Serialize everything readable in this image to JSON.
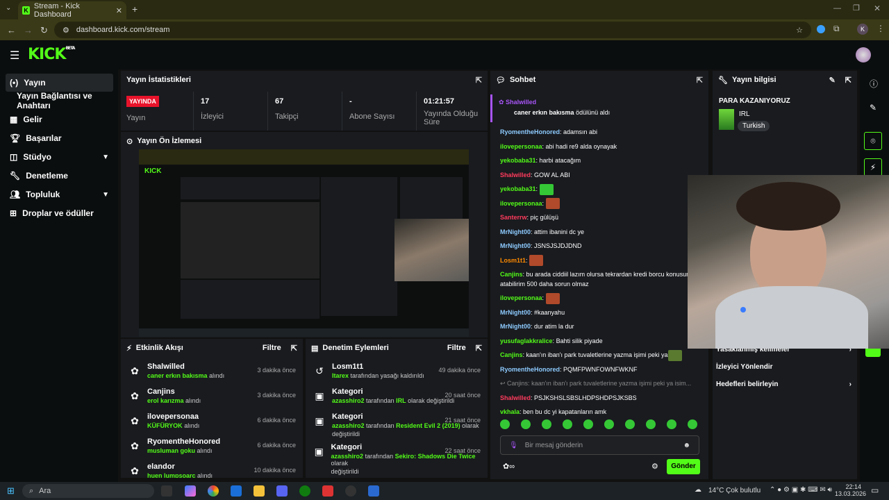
{
  "browser": {
    "tab_title": "Stream - Kick Dashboard",
    "url": "dashboard.kick.com/stream",
    "profile_initial": "K"
  },
  "logo": {
    "text": "KICK",
    "beta": "BETA"
  },
  "sidebar": {
    "items": [
      {
        "label": "Yayın",
        "icon": "broadcast-icon"
      },
      {
        "label": "Yayın Bağlantısı ve Anahtarı",
        "icon": ""
      },
      {
        "label": "Gelir",
        "icon": "revenue-icon"
      },
      {
        "label": "Başarılar",
        "icon": "trophy-icon"
      },
      {
        "label": "Stüdyo",
        "icon": "studio-icon"
      },
      {
        "label": "Denetleme",
        "icon": "wrench-icon"
      },
      {
        "label": "Topluluk",
        "icon": "community-icon"
      },
      {
        "label": "Droplar ve ödüller",
        "icon": "gift-icon"
      }
    ]
  },
  "stats": {
    "title": "Yayın İstatistikleri",
    "live": "YAYINDA",
    "live_label": "Yayın",
    "items": [
      {
        "value": "17",
        "label": "İzleyici"
      },
      {
        "value": "67",
        "label": "Takipçi"
      },
      {
        "value": "-",
        "label": "Abone Sayısı"
      },
      {
        "value": "01:21:57",
        "label": "Yayında Olduğu Süre"
      }
    ]
  },
  "preview": {
    "title": "Yayın Ön İzlemesi"
  },
  "activity": {
    "title": "Etkinlik Akışı",
    "filter": "Filtre",
    "items": [
      {
        "name": "Shalwilled",
        "detail": "caner erkın bakısma",
        "suffix": "alındı",
        "time": "3 dakika önce"
      },
      {
        "name": "Canjins",
        "detail": "erol karızma",
        "suffix": "alındı",
        "time": "3 dakika önce"
      },
      {
        "name": "ilovepersonaa",
        "detail": "KÜFÜRYOK",
        "suffix": "alındı",
        "time": "6 dakika önce"
      },
      {
        "name": "RyomentheHonored",
        "detail": "musluman goku",
        "suffix": "alındı",
        "time": "6 dakika önce"
      },
      {
        "name": "elandor",
        "detail": "huen lumpsoarc",
        "suffix": "alındı",
        "time": "10 dakika önce"
      }
    ]
  },
  "moderation": {
    "title": "Denetim Eylemleri",
    "filter": "Filtre",
    "items": [
      {
        "name": "Losm1t1",
        "line": "Itarex",
        "rest": "tarafından yasağı kaldırıldı",
        "line2": "",
        "time": "49 dakika önce"
      },
      {
        "name": "Kategori",
        "line": "azasshiro2",
        "rest": "tarafından",
        "hl": "IRL",
        "rest2": "olarak değiştirildi",
        "line2": "",
        "time": "20 saat önce"
      },
      {
        "name": "Kategori",
        "line": "azasshiro2",
        "rest": "tarafından",
        "hl": "Resident Evil 2 (2019)",
        "rest2": "olarak",
        "line2": "değiştirildi",
        "time": "21 saat önce"
      },
      {
        "name": "Kategori",
        "line": "azasshiro2",
        "rest": "tarafından",
        "hl": "Sekiro: Shadows Die Twice",
        "rest2": "olarak",
        "line2": "değiştirildi",
        "time": "22 saat önce"
      }
    ]
  },
  "chat": {
    "title": "Sohbet",
    "pinned_user": "Shalwilled",
    "pinned_text": "caner erkın bakısma",
    "pinned_suffix": "ödülünü aldı",
    "messages": [
      {
        "user": "RyomentheHonored",
        "color": "#8ecbff",
        "text": "adamsın abi"
      },
      {
        "user": "ilovepersonaa",
        "color": "#53fc18",
        "text": "abi hadi re9 alda oynayak"
      },
      {
        "user": "yekobaba31",
        "color": "#53fc18",
        "text": "harbi atacağım"
      },
      {
        "user": "Shalwilled",
        "color": "#ff3b5c",
        "text": "GOW AL ABI"
      },
      {
        "user": "yekobaba31",
        "color": "#53fc18",
        "text": ""
      },
      {
        "user": "ilovepersonaa",
        "color": "#53fc18",
        "text": ""
      },
      {
        "user": "Santerrw",
        "color": "#ff3b5c",
        "text": "piç gülüşü"
      },
      {
        "user": "MrNight00",
        "color": "#8ecbff",
        "text": "attim ibanini dc ye"
      },
      {
        "user": "MrNight00",
        "color": "#8ecbff",
        "text": "JSNSJSJDJDND"
      },
      {
        "user": "Losm1t1",
        "color": "#ff8a00",
        "text": ""
      },
      {
        "user": "Canjins",
        "color": "#53fc18",
        "text": "bu arada ciddiil lazım olursa tekrardan kredi borcu konusunda atabilirim 500 daha sorun olmaz"
      },
      {
        "user": "ilovepersonaa",
        "color": "#53fc18",
        "text": ""
      },
      {
        "user": "MrNight00",
        "color": "#8ecbff",
        "text": "#kaanyahu"
      },
      {
        "user": "MrNight00",
        "color": "#8ecbff",
        "text": "dur atim la dur"
      },
      {
        "user": "yusufaglakkralice",
        "color": "#53fc18",
        "text": "Bahti silik piyade"
      },
      {
        "user": "Canjins",
        "color": "#53fc18",
        "text": "kaan'ın iban'ı park tuvaletlerine yazma işimi peki ya"
      },
      {
        "user": "RyomentheHonored",
        "color": "#8ecbff",
        "text": "PQMFPWNFOWNFWKNF"
      }
    ],
    "reply_preview": "Canjins: kaan'ın iban'ı park tuvaletlerine yazma işimi peki ya",
    "reply_suffix": "isim...",
    "messages2": [
      {
        "user": "Shalwilled",
        "color": "#ff3b5c",
        "text": "PSJKSHSLSBSLHDPSHDPSJKSBS"
      },
      {
        "user": "vkhala",
        "color": "#53fc18",
        "text": "ben bu dc yi kapatanların amk"
      }
    ],
    "placeholder": "Bir mesaj gönderin",
    "send": "Gönder"
  },
  "info": {
    "title": "Yayın bilgisi",
    "stream_title": "PARA KAZANIYORUZ",
    "category": "IRL",
    "language": "Turkish",
    "links": [
      "Yasaklanmış kelimeler",
      "İzleyici Yönlendir",
      "Hedefleri belirleyin"
    ]
  },
  "taskbar": {
    "search": "Ara",
    "weather": "14°C  Çok bulutlu",
    "time": "22:14",
    "date": "13.03.2026"
  },
  "colors": {
    "accent": "#53fc18",
    "live": "#e8132b",
    "panel": "#191b1f"
  }
}
